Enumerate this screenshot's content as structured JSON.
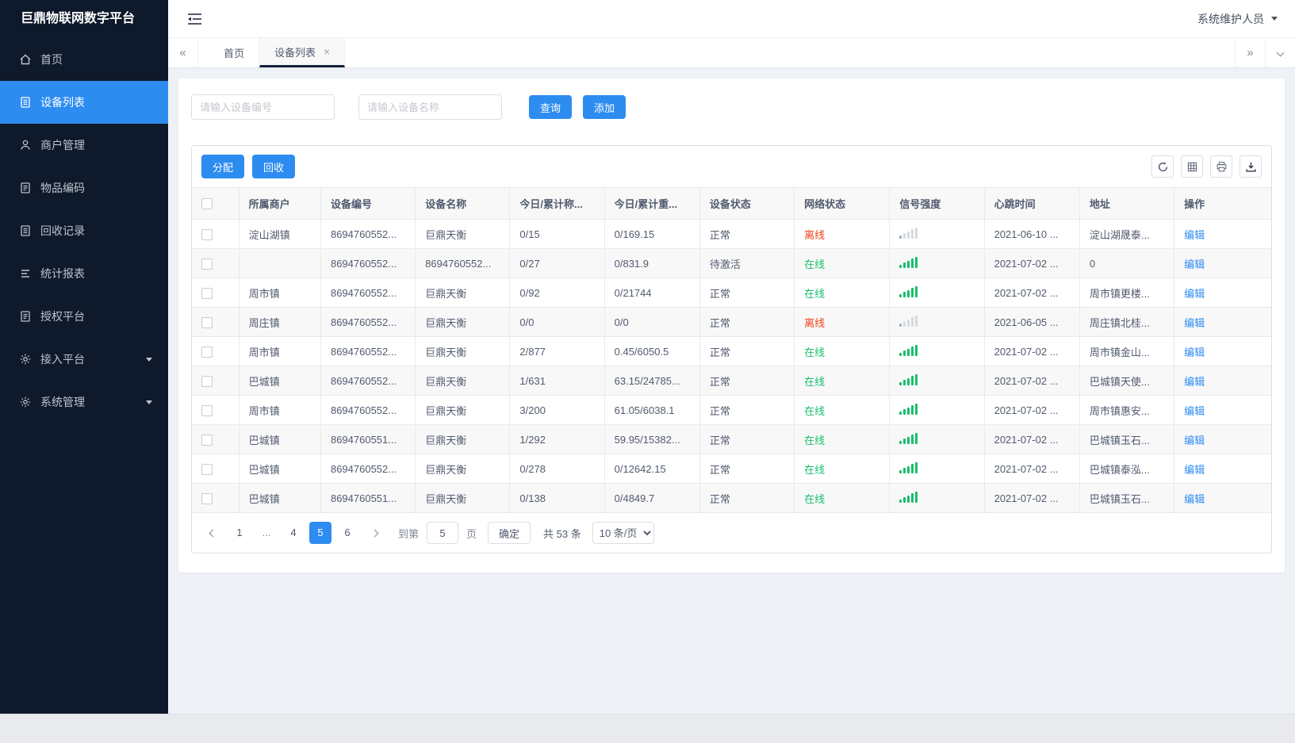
{
  "app": {
    "title": "巨鼎物联网数字平台",
    "user": "系统维护人员"
  },
  "sidebar": {
    "items": [
      {
        "label": "首页"
      },
      {
        "label": "设备列表"
      },
      {
        "label": "商户管理"
      },
      {
        "label": "物品编码"
      },
      {
        "label": "回收记录"
      },
      {
        "label": "统计报表"
      },
      {
        "label": "授权平台"
      },
      {
        "label": "接入平台"
      },
      {
        "label": "系统管理"
      }
    ]
  },
  "tabs": {
    "home": "首页",
    "device_list": "设备列表"
  },
  "search": {
    "device_no_placeholder": "请输入设备编号",
    "device_name_placeholder": "请输入设备名称",
    "query_label": "查询",
    "add_label": "添加"
  },
  "toolbar": {
    "assign_label": "分配",
    "recycle_label": "回收"
  },
  "table": {
    "columns": {
      "merchant": "所属商户",
      "device_no": "设备编号",
      "device_name": "设备名称",
      "today_count": "今日/累计称...",
      "today_weight": "今日/累计重...",
      "device_status": "设备状态",
      "network_status": "网络状态",
      "signal": "信号强度",
      "heartbeat": "心跳时间",
      "address": "地址",
      "action": "操作"
    },
    "rows": [
      {
        "merchant": "淀山湖镇",
        "device_no": "8694760552...",
        "device_name": "巨鼎天衡",
        "today_count": "0/15",
        "today_weight": "0/169.15",
        "device_status": "正常",
        "network_status": "离线",
        "network_online": false,
        "signal": "weak",
        "heartbeat": "2021-06-10 ...",
        "address": "淀山湖晟泰...",
        "action": "编辑"
      },
      {
        "merchant": "",
        "device_no": "8694760552...",
        "device_name": "8694760552...",
        "today_count": "0/27",
        "today_weight": "0/831.9",
        "device_status": "待激活",
        "network_status": "在线",
        "network_online": true,
        "signal": "strong",
        "heartbeat": "2021-07-02 ...",
        "address": "0",
        "action": "编辑"
      },
      {
        "merchant": "周市镇",
        "device_no": "8694760552...",
        "device_name": "巨鼎天衡",
        "today_count": "0/92",
        "today_weight": "0/21744",
        "device_status": "正常",
        "network_status": "在线",
        "network_online": true,
        "signal": "strong",
        "heartbeat": "2021-07-02 ...",
        "address": "周市镇更楼...",
        "action": "编辑"
      },
      {
        "merchant": "周庄镇",
        "device_no": "8694760552...",
        "device_name": "巨鼎天衡",
        "today_count": "0/0",
        "today_weight": "0/0",
        "device_status": "正常",
        "network_status": "离线",
        "network_online": false,
        "signal": "weak",
        "heartbeat": "2021-06-05 ...",
        "address": "周庄镇北桂...",
        "action": "编辑"
      },
      {
        "merchant": "周市镇",
        "device_no": "8694760552...",
        "device_name": "巨鼎天衡",
        "today_count": "2/877",
        "today_weight": "0.45/6050.5",
        "device_status": "正常",
        "network_status": "在线",
        "network_online": true,
        "signal": "strong",
        "heartbeat": "2021-07-02 ...",
        "address": "周市镇金山...",
        "action": "编辑"
      },
      {
        "merchant": "巴城镇",
        "device_no": "8694760552...",
        "device_name": "巨鼎天衡",
        "today_count": "1/631",
        "today_weight": "63.15/24785...",
        "device_status": "正常",
        "network_status": "在线",
        "network_online": true,
        "signal": "strong",
        "heartbeat": "2021-07-02 ...",
        "address": "巴城镇天使...",
        "action": "编辑"
      },
      {
        "merchant": "周市镇",
        "device_no": "8694760552...",
        "device_name": "巨鼎天衡",
        "today_count": "3/200",
        "today_weight": "61.05/6038.1",
        "device_status": "正常",
        "network_status": "在线",
        "network_online": true,
        "signal": "strong",
        "heartbeat": "2021-07-02 ...",
        "address": "周市镇惠安...",
        "action": "编辑"
      },
      {
        "merchant": "巴城镇",
        "device_no": "8694760551...",
        "device_name": "巨鼎天衡",
        "today_count": "1/292",
        "today_weight": "59.95/15382...",
        "device_status": "正常",
        "network_status": "在线",
        "network_online": true,
        "signal": "strong",
        "heartbeat": "2021-07-02 ...",
        "address": "巴城镇玉石...",
        "action": "编辑"
      },
      {
        "merchant": "巴城镇",
        "device_no": "8694760552...",
        "device_name": "巨鼎天衡",
        "today_count": "0/278",
        "today_weight": "0/12642.15",
        "device_status": "正常",
        "network_status": "在线",
        "network_online": true,
        "signal": "strong",
        "heartbeat": "2021-07-02 ...",
        "address": "巴城镇泰泓...",
        "action": "编辑"
      },
      {
        "merchant": "巴城镇",
        "device_no": "8694760551...",
        "device_name": "巨鼎天衡",
        "today_count": "0/138",
        "today_weight": "0/4849.7",
        "device_status": "正常",
        "network_status": "在线",
        "network_online": true,
        "signal": "strong",
        "heartbeat": "2021-07-02 ...",
        "address": "巴城镇玉石...",
        "action": "编辑"
      }
    ]
  },
  "pagination": {
    "pages": [
      "1",
      "...",
      "4",
      "5",
      "6"
    ],
    "current": "5",
    "goto_label": "到第",
    "goto_value": "5",
    "page_unit": "页",
    "confirm_label": "确定",
    "total_label": "共 53 条",
    "page_size": "10 条/页"
  },
  "colors": {
    "primary": "#2d8cf0",
    "online": "#19be6b",
    "offline": "#ed4014",
    "sidebar_bg": "#0e1a2b"
  }
}
